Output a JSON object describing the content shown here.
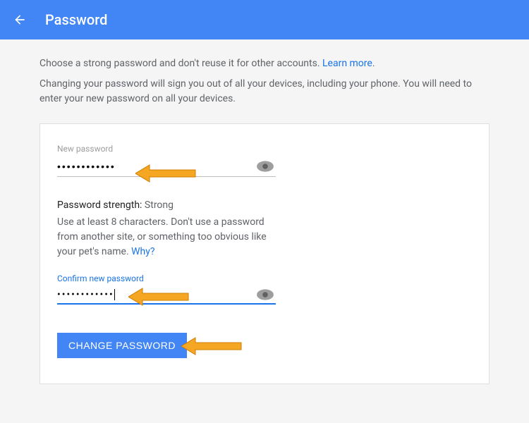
{
  "header": {
    "title": "Password"
  },
  "intro": {
    "line1_prefix": "Choose a strong password and don't reuse it for other accounts. ",
    "learn_more": "Learn more",
    "line1_suffix": ".",
    "line2": "Changing your password will sign you out of all your devices, including your phone. You will need to enter your new password on all your devices."
  },
  "form": {
    "new_password_label": "New password",
    "new_password_value": "••••••••••••",
    "confirm_label": "Confirm new password",
    "confirm_value": "••••••••••••",
    "strength_label": "Password strength:",
    "strength_value": "Strong",
    "hint_prefix": "Use at least 8 characters. Don't use a password from another site, or something too obvious like your pet's name. ",
    "why_link": "Why?",
    "submit_label": "Change Password"
  }
}
